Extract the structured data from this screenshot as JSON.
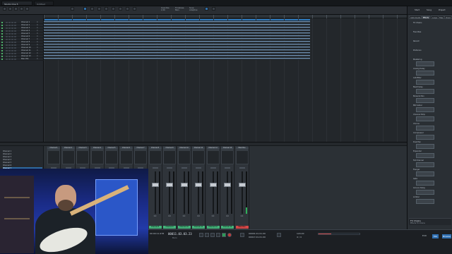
{
  "app": {
    "title": "Studio One 5"
  },
  "tabs": [
    {
      "label": "Studio One 5",
      "active": true
    },
    {
      "label": "Untitled"
    }
  ],
  "toolbar": {
    "groups": [
      {
        "label": "Quantize",
        "value": "1/16"
      },
      {
        "label": "Timebase",
        "value": "Bars"
      },
      {
        "label": "Snap",
        "value": "Adaptive"
      }
    ],
    "right_buttons": [
      "Start",
      "Song",
      "Project"
    ]
  },
  "tracks": [
    {
      "name": "Channel 1",
      "color": "#4fb36a",
      "val": "0"
    },
    {
      "name": "Channel 2",
      "color": "#4fb36a",
      "val": "0"
    },
    {
      "name": "Channel 3",
      "color": "#4fb36a",
      "val": "0"
    },
    {
      "name": "Channel 4",
      "color": "#4fb36a",
      "val": "0"
    },
    {
      "name": "Channel 5",
      "color": "#4fb36a",
      "val": "0"
    },
    {
      "name": "Channel 6",
      "color": "#4fb36a",
      "val": "0"
    },
    {
      "name": "Channel 7",
      "color": "#4fb36a",
      "val": "0"
    },
    {
      "name": "Channel 8",
      "color": "#4fb36a",
      "val": "0"
    },
    {
      "name": "Channel 9",
      "color": "#4fb36a",
      "val": "0"
    },
    {
      "name": "Channel 10",
      "color": "#4fb36a",
      "val": "0"
    },
    {
      "name": "Channel 11",
      "color": "#4fb36a",
      "val": "0"
    },
    {
      "name": "Channel 12",
      "color": "#4fb36a",
      "val": "0"
    },
    {
      "name": "Channel 13",
      "color": "#4fb36a",
      "val": "0"
    },
    {
      "name": "Main Mix",
      "color": "#4fb36a",
      "val": "0"
    }
  ],
  "right_panel": {
    "top_buttons": [
      "Start",
      "Song",
      "Project"
    ],
    "tabs": [
      "Instruments",
      "Effects",
      "Loops",
      "Files",
      "Cloud"
    ],
    "items": [
      "FX Chains",
      "Favorites",
      "Recent",
      "PreSonus",
      "Mastering",
      "Analog Delay",
      "Autofilter",
      "Beat Delay",
      "Binaural Pan",
      "Bitcrusher",
      "Channel Strip",
      "Chorus",
      "Compressor",
      "Dual Pan",
      "Expander",
      "Fat Channel",
      "Flanger",
      "Gate",
      "Groove Delay",
      "Limiter"
    ],
    "footer_title": "FX Chains",
    "footer_sub": "Effects FX Chains"
  },
  "console": {
    "channel_list": [
      "Channel 1",
      "Channel 2",
      "Channel 3",
      "Channel 4",
      "Channel 5",
      "Channel 6",
      "Channel 7",
      "Channel 8",
      "Channel 9"
    ],
    "strips": [
      {
        "name": "Channel 1",
        "label": "Channel 1",
        "color": "#44b27a",
        "level": 0.3,
        "vol": "0.0"
      },
      {
        "name": "Channel 2",
        "label": "Channel 2",
        "color": "#44b27a",
        "level": 0.0,
        "vol": "0.0"
      },
      {
        "name": "Channel 3",
        "label": "Channel 3",
        "color": "#44b27a",
        "level": 0.0,
        "vol": "0.0"
      },
      {
        "name": "Channel 4",
        "label": "Channel 4",
        "color": "#44b27a",
        "level": 0.55,
        "vol": "0.0"
      },
      {
        "name": "Channel 5",
        "label": "Channel 5",
        "color": "#44b27a",
        "level": 0.0,
        "vol": "0.0"
      },
      {
        "name": "Channel 6",
        "label": "Channel 6",
        "color": "#44b27a",
        "level": 0.0,
        "vol": "0.0"
      },
      {
        "name": "Channel 7",
        "label": "Channel 7",
        "color": "#44b27a",
        "level": 0.0,
        "vol": "0.0"
      },
      {
        "name": "Channel 8",
        "label": "Channel 8",
        "color": "#44b27a",
        "level": 0.0,
        "vol": "0.0"
      },
      {
        "name": "Channel 9",
        "label": "Channel 9",
        "color": "#44b27a",
        "level": 0.0,
        "vol": "0.0"
      },
      {
        "name": "Channel 10",
        "label": "Channel 10",
        "color": "#44b27a",
        "level": 0.0,
        "vol": "0.0"
      },
      {
        "name": "Channel 11",
        "label": "Channel 11",
        "color": "#44b27a",
        "level": 0.0,
        "vol": "0.0"
      },
      {
        "name": "Channel 12",
        "label": "Channel 12",
        "color": "#44b27a",
        "level": 0.0,
        "vol": "0.0"
      },
      {
        "name": "Channel 13",
        "label": "Channel 13",
        "color": "#44b27a",
        "level": 0.0,
        "vol": "0.0"
      },
      {
        "name": "Main Bus",
        "label": "Main Bus",
        "color": "#d44848",
        "level": 0.15,
        "vol": "0.0"
      }
    ]
  },
  "transport": {
    "time_left": "00011.03.03.23",
    "time_sub": "Bars",
    "loop_start": "00001.01.01.00",
    "loop_end": "00017.01.01.00",
    "tempo": "120.00",
    "sig": "4 / 4",
    "edit": "Edit",
    "mix": "Mix",
    "browse": "Browse",
    "perf": "00:00:11.978"
  },
  "colors": {
    "accent": "#2f7bbf",
    "clip": "#3c4853",
    "green": "#44b27a",
    "red": "#d44848"
  }
}
